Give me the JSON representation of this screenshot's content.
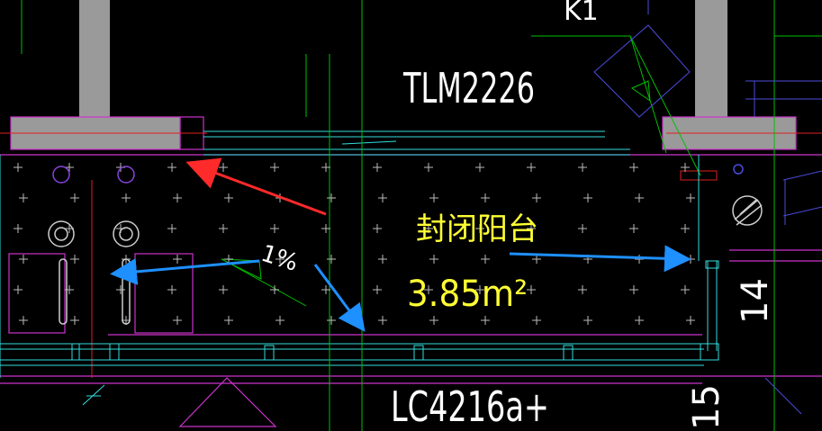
{
  "labels": {
    "door_code": "TLM2226",
    "window_code": "LC4216a+",
    "room_name": "封闭阳台",
    "room_area": "3.85m²",
    "slope": "1%",
    "top_right_code": "K1",
    "side_dim_a": "14",
    "side_dim_b": "15"
  },
  "colors": {
    "background": "#000000",
    "wall_fill": "#9a9a9a",
    "green_line": "#00c000",
    "magenta_line": "#cc33cc",
    "cyan_line": "#33dddd",
    "red_line": "#e02020",
    "white_text": "#ffffff",
    "yellow_text": "#ffff33",
    "blue_arrow": "#1e90ff",
    "red_arrow": "#ff2a2a",
    "blue_purple": "#4b4bdd"
  },
  "icons": {
    "arrow_red": "red-arrow-icon",
    "arrow_blue": "blue-arrow-icon",
    "drain": "floor-drain-icon"
  }
}
